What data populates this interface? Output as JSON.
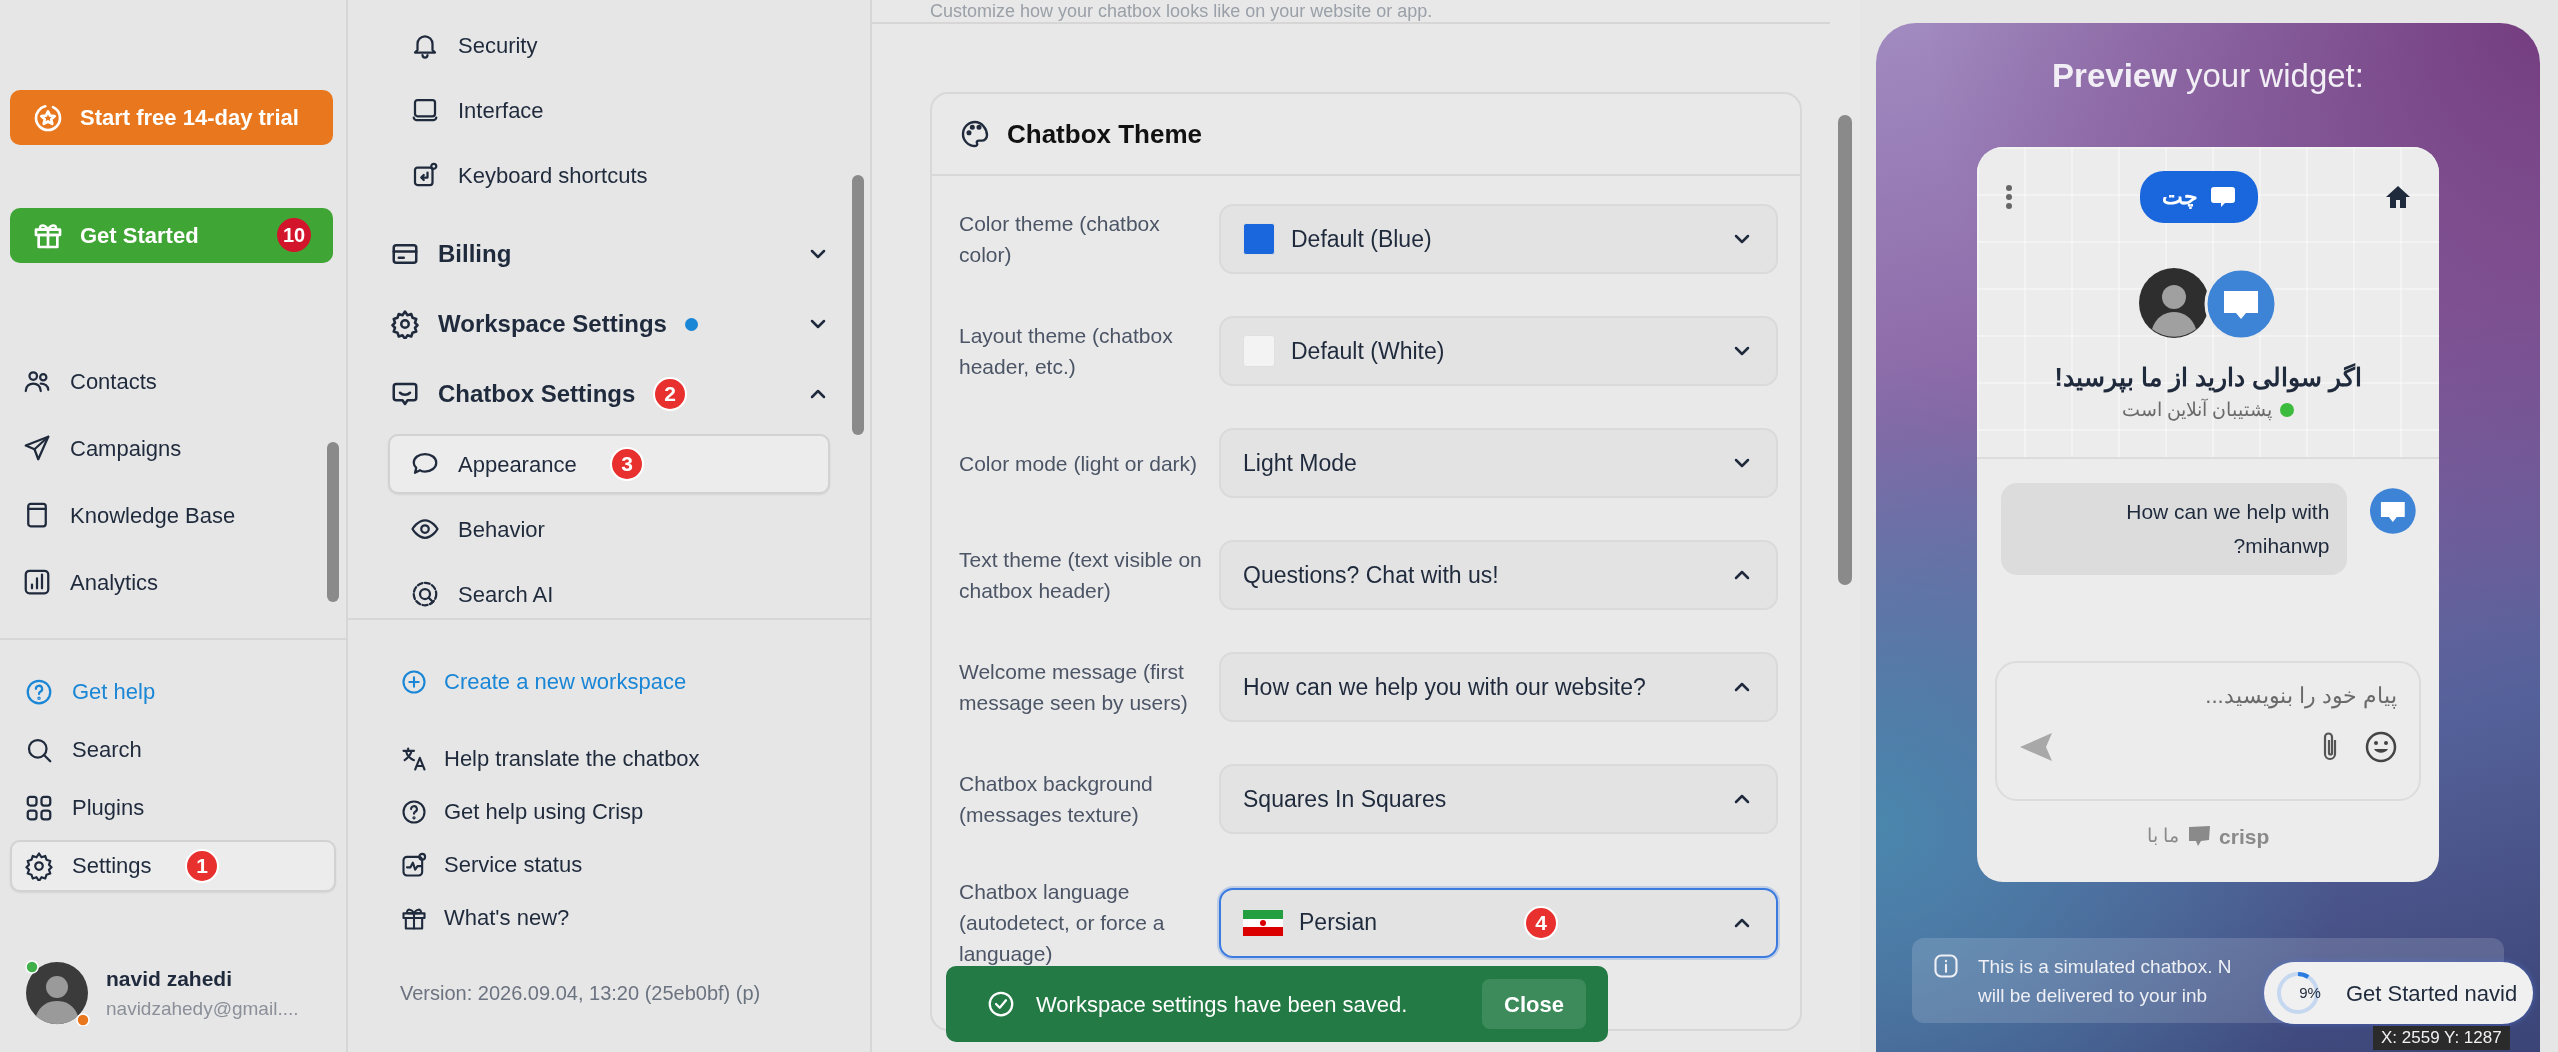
{
  "sidebar": {
    "trial_button": "Start free 14-day trial",
    "get_started": {
      "label": "Get Started",
      "count": "10"
    },
    "nav": [
      {
        "label": "Contacts",
        "selected": false
      },
      {
        "label": "Campaigns",
        "selected": false
      },
      {
        "label": "Knowledge Base",
        "selected": false
      },
      {
        "label": "Analytics",
        "selected": false
      }
    ],
    "bottom": [
      {
        "label": "Get help",
        "kind": "help",
        "selected": false
      },
      {
        "label": "Search",
        "kind": "plain",
        "selected": false
      },
      {
        "label": "Plugins",
        "kind": "plain",
        "selected": false
      },
      {
        "label": "Settings",
        "kind": "plain",
        "selected": true,
        "step": "1"
      }
    ],
    "user": {
      "name": "navid zahedi",
      "email": "navidzahedy@gmail...."
    }
  },
  "menu": {
    "items": [
      {
        "kind": "sub",
        "label": "Security",
        "selected": false
      },
      {
        "kind": "sub",
        "label": "Interface",
        "selected": false
      },
      {
        "kind": "sub",
        "label": "Keyboard shortcuts",
        "selected": false
      },
      {
        "kind": "section",
        "label": "Billing",
        "expanded": false,
        "dot": false
      },
      {
        "kind": "section",
        "label": "Workspace Settings",
        "expanded": false,
        "dot": true
      },
      {
        "kind": "section",
        "label": "Chatbox Settings",
        "expanded": true,
        "dot": false,
        "step": "2"
      },
      {
        "kind": "sub",
        "label": "Appearance",
        "selected": true,
        "step": "3"
      },
      {
        "kind": "sub",
        "label": "Behavior",
        "selected": false
      },
      {
        "kind": "sub",
        "label": "Search AI",
        "selected": false
      }
    ],
    "create_workspace": "Create a new workspace",
    "links": [
      "Help translate the chatbox",
      "Get help using Crisp",
      "Service status",
      "What's new?"
    ],
    "version": "Version: 2026.09.04, 13:20 (25eb0bf) (p)"
  },
  "main": {
    "subtitle": "Customize how your chatbox looks like on your website or app.",
    "card_title": "Chatbox Theme",
    "fields": [
      {
        "label": "Color theme (chatbox color)",
        "value": "Default (Blue)",
        "kind": "swatch",
        "color": "#1a66dc",
        "expanded": false,
        "focused": false
      },
      {
        "label": "Layout theme (chatbox header, etc.)",
        "value": "Default (White)",
        "kind": "swatch",
        "color": "#f3f3f3",
        "expanded": false,
        "focused": false
      },
      {
        "label": "Color mode (light or dark)",
        "value": "Light Mode",
        "kind": "plain",
        "expanded": false,
        "focused": false
      },
      {
        "label": "Text theme (text visible on chatbox header)",
        "value": "Questions? Chat with us!",
        "kind": "plain",
        "expanded": true,
        "focused": false
      },
      {
        "label": "Welcome message (first message seen by users)",
        "value": "How can we help you with our website?",
        "kind": "plain",
        "expanded": true,
        "focused": false
      },
      {
        "label": "Chatbox background (messages texture)",
        "value": "Squares In Squares",
        "kind": "plain",
        "expanded": true,
        "focused": false
      },
      {
        "label": "Chatbox language (autodetect, or force a language)",
        "value": "Persian",
        "kind": "flag",
        "expanded": true,
        "focused": true,
        "step": "4"
      }
    ],
    "toast": {
      "message": "Workspace settings have been saved.",
      "action": "Close"
    }
  },
  "preview": {
    "title": "**Preview** your widget:",
    "widget": {
      "header_button": "چت",
      "heading": "اگر سوالی دارید از ما بپرسید!",
      "status": "پشتیبان آنلاین است",
      "online": true,
      "message": "How can we help with mihanwp?",
      "placeholder": "پیام خود را بنویسید...",
      "footer": "ما با",
      "brand": "crisp"
    },
    "notice": [
      "This is a simulated chatbox. N",
      "will be delivered to your inb"
    ],
    "pill": {
      "progress": "9%",
      "level": 0.09,
      "label": "Get Started navid"
    },
    "readout": "X: 2559 Y: 1287"
  }
}
